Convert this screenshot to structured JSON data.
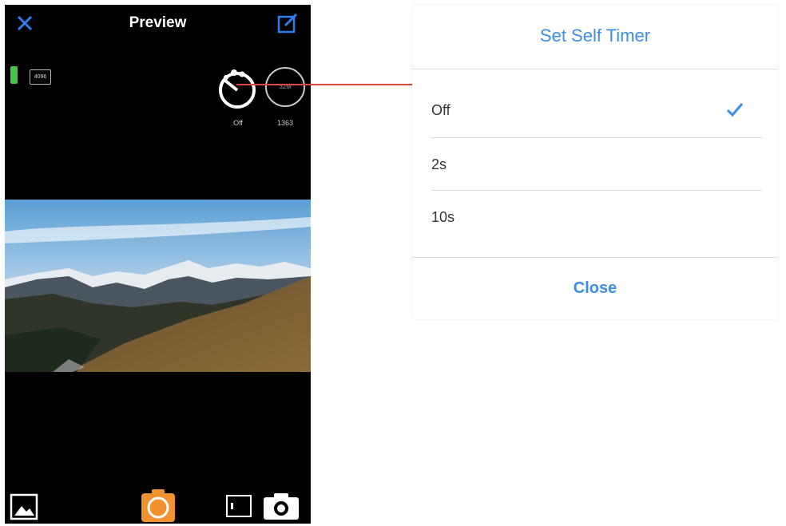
{
  "phone": {
    "nav": {
      "title": "Preview",
      "close_icon": "close-x-icon",
      "edit_icon": "edit-icon"
    },
    "status": {
      "battery_icon": "battery-icon",
      "resolution_badge": "4096"
    },
    "controls": {
      "timer_label": "Off",
      "resolution_value": "32M",
      "count_label": "1363"
    },
    "bottom_bar": {
      "gallery_icon": "gallery-icon",
      "shutter_icon": "shutter-icon",
      "mode_icon": "mode-icon",
      "camera_icon": "camera-icon"
    }
  },
  "dialog": {
    "title": "Set Self Timer",
    "options": [
      {
        "label": "Off",
        "selected": true
      },
      {
        "label": "2s",
        "selected": false
      },
      {
        "label": "10s",
        "selected": false
      }
    ],
    "close_label": "Close"
  },
  "colors": {
    "accent": "#3d8ee8",
    "shutter": "#f2922e",
    "connector": "#e0463a",
    "battery": "#3ec93e"
  }
}
